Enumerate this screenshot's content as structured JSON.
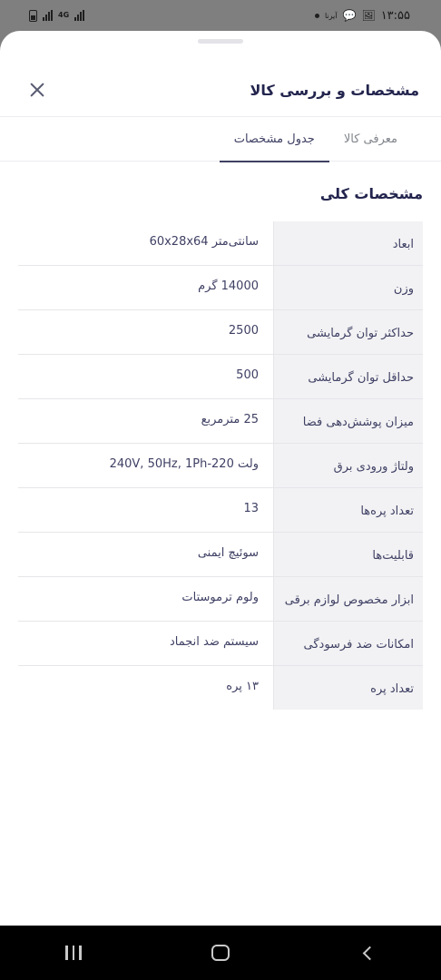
{
  "status_bar": {
    "network_type": "4G",
    "small_label": "آیرنا",
    "time": "۱۳:۵۵"
  },
  "header": {
    "title": "مشخصات و بررسی کالا"
  },
  "tabs": [
    {
      "label": "معرفی کالا"
    },
    {
      "label": "جدول مشخصات"
    }
  ],
  "section": {
    "title": "مشخصات کلی"
  },
  "specs": [
    {
      "key": "ابعاد",
      "value": "سانتی‌متر 60x28x64"
    },
    {
      "key": "وزن",
      "value": "14000 گرم"
    },
    {
      "key": "حداکثر توان گرمایشی",
      "value": "2500"
    },
    {
      "key": "حداقل توان گرمایشی",
      "value": "500"
    },
    {
      "key": "میزان پوشش‌دهی فضا",
      "value": "25 مترمربع"
    },
    {
      "key": "ولتاژ ورودی برق",
      "value": "ولت 220-240V, 50Hz, 1Ph"
    },
    {
      "key": "تعداد پره‌ها",
      "value": "13"
    },
    {
      "key": "قابلیت‌ها",
      "value": "سوئیچ ایمنی"
    },
    {
      "key": "ابزار مخصوص لوازم برقی",
      "value": "ولوم ترموستات"
    },
    {
      "key": "امکانات ضد فرسودگی",
      "value": "سیستم ضد انجماد"
    },
    {
      "key": "تعداد پره",
      "value": "۱۳ پره"
    }
  ]
}
